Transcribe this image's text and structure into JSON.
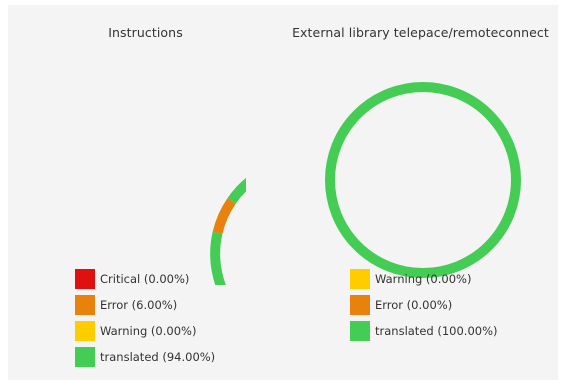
{
  "colors": {
    "critical": "#e01010",
    "error": "#e8820c",
    "warning": "#ffcc00",
    "translated": "#44cc55"
  },
  "charts": [
    {
      "title": "Instructions",
      "segments": [
        {
          "key": "critical",
          "label": "Critical (0.00%)",
          "value": 0.0,
          "color": "#e01010"
        },
        {
          "key": "error",
          "label": "Error (6.00%)",
          "value": 6.0,
          "color": "#e8820c"
        },
        {
          "key": "warning",
          "label": "Warning (0.00%)",
          "value": 0.0,
          "color": "#ffcc00"
        },
        {
          "key": "translated",
          "label": "translated (94.00%)",
          "value": 94.0,
          "color": "#44cc55"
        }
      ]
    },
    {
      "title": "External library telepace/remoteconnect",
      "segments": [
        {
          "key": "warning",
          "label": "Warning (0.00%)",
          "value": 0.0,
          "color": "#ffcc00"
        },
        {
          "key": "error",
          "label": "Error (0.00%)",
          "value": 0.0,
          "color": "#e8820c"
        },
        {
          "key": "translated",
          "label": "translated (100.00%)",
          "value": 100.0,
          "color": "#44cc55"
        }
      ]
    }
  ],
  "chart_data": [
    {
      "type": "pie",
      "title": "Instructions",
      "categories": [
        "Critical",
        "Error",
        "Warning",
        "translated"
      ],
      "values": [
        0.0,
        6.0,
        0.0,
        94.0
      ]
    },
    {
      "type": "pie",
      "title": "External library telepace/remoteconnect",
      "categories": [
        "Warning",
        "Error",
        "translated"
      ],
      "values": [
        0.0,
        0.0,
        100.0
      ]
    }
  ]
}
